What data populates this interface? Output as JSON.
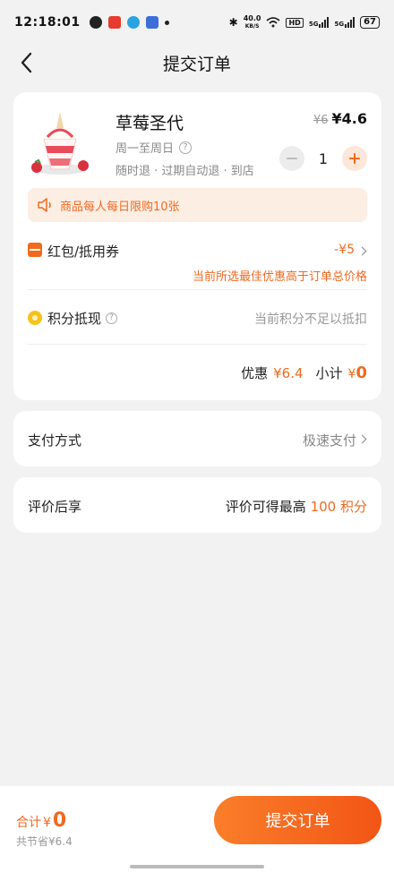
{
  "status_bar": {
    "time": "12:18:01",
    "net_speed_value": "40.0",
    "net_speed_unit": "KB/S",
    "hd_label": "HD",
    "signal_label_1": "5G",
    "signal_label_2": "5G",
    "battery": "67"
  },
  "nav": {
    "title": "提交订单"
  },
  "product": {
    "name": "草莓圣代",
    "schedule": "周一至周日",
    "policy": "随时退 · 过期自动退 · 到店",
    "original_price": "¥6",
    "price": "¥4.6",
    "quantity": "1"
  },
  "limit_notice": "商品每人每日限购10张",
  "coupon": {
    "label": "红包/抵用券",
    "value": "-¥5",
    "note": "当前所选最佳优惠高于订单总价格"
  },
  "points": {
    "label": "积分抵现",
    "note": "当前积分不足以抵扣"
  },
  "summary": {
    "discount_label": "优惠",
    "discount_value": "¥6.4",
    "subtotal_label": "小计",
    "subtotal_currency": "¥",
    "subtotal_value": "0"
  },
  "payment": {
    "label": "支付方式",
    "value": "极速支付"
  },
  "review": {
    "label": "评价后享",
    "prefix": "评价可得最高",
    "points": "100 积分"
  },
  "bottom": {
    "total_label": "合计",
    "total_currency": "¥",
    "total_value": "0",
    "save_text": "共节省¥6.4",
    "submit_label": "提交订单"
  },
  "colors": {
    "accent": "#f26a1b",
    "accent_light": "#fdeee4"
  }
}
